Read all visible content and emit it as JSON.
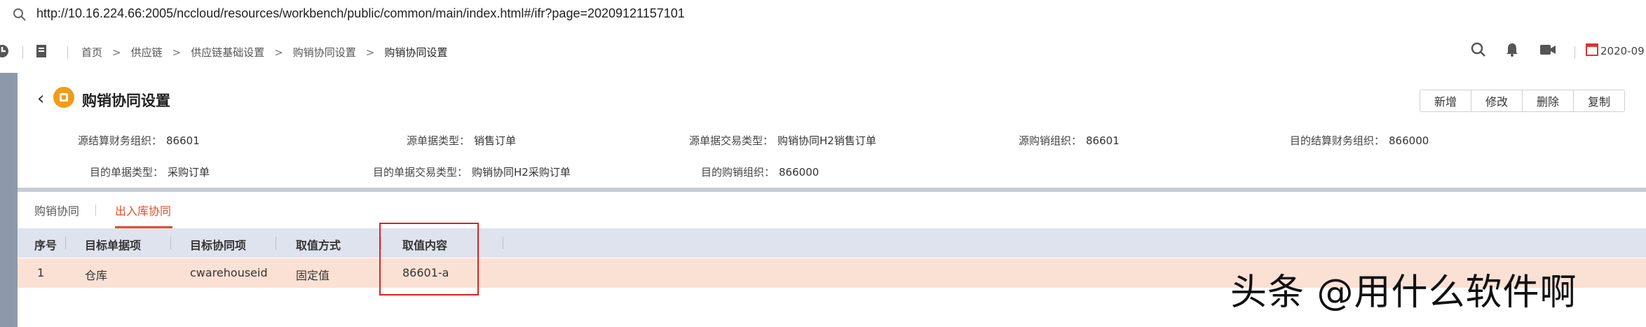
{
  "address_bar": {
    "url": "http://10.16.224.66:2005/nccloud/resources/workbench/public/common/main/index.html#/ifr?page=20209121157101"
  },
  "nav": {
    "breadcrumb": [
      "首页",
      "供应链",
      "供应链基础设置",
      "购销协同设置",
      "购销协同设置"
    ],
    "date": "2020-09"
  },
  "page": {
    "title": "购销协同设置",
    "buttons": [
      "新增",
      "修改",
      "删除",
      "复制"
    ]
  },
  "info": {
    "row1": [
      {
        "label": "源结算财务组织：",
        "value": "86601"
      },
      {
        "label": "源单据类型：",
        "value": "销售订单"
      },
      {
        "label": "源单据交易类型：",
        "value": "购销协同H2销售订单"
      },
      {
        "label": "源购销组织：",
        "value": "86601"
      },
      {
        "label": "目的结算财务组织：",
        "value": "866000"
      }
    ],
    "row2": [
      {
        "label": "目的单据类型：",
        "value": "采购订单"
      },
      {
        "label": "目的单据交易类型：",
        "value": "购销协同H2采购订单"
      },
      {
        "label": "目的购销组织：",
        "value": "866000"
      }
    ]
  },
  "tabs": [
    {
      "label": "购销协同",
      "active": false
    },
    {
      "label": "出入库协同",
      "active": true
    }
  ],
  "table": {
    "columns": [
      "序号",
      "目标单据项",
      "目标协同项",
      "取值方式",
      "取值内容"
    ],
    "rows": [
      [
        "1",
        "仓库",
        "cwarehouseid",
        "固定值",
        "86601-a"
      ]
    ]
  },
  "watermark": "头条 @用什么软件啊",
  "colors": {
    "accent": "#e14d2a",
    "row_highlight": "#fbe1d4",
    "header_bg": "#dfe3ee",
    "annotation_box": "#e02020"
  }
}
